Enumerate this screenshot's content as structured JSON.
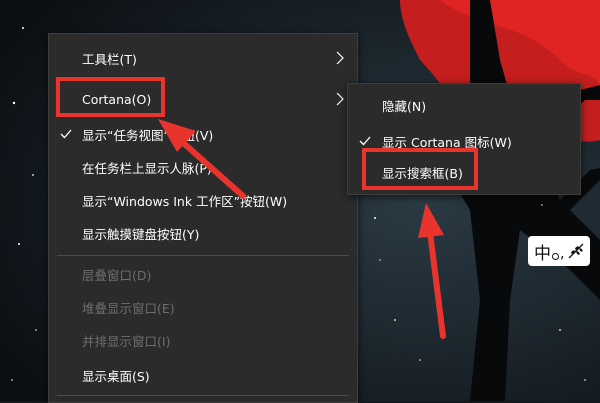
{
  "context_menu": {
    "items": [
      {
        "label": "工具栏(T)",
        "state": "normal",
        "has_submenu": true,
        "checked": false
      },
      {
        "label": "Cortana(O)",
        "state": "normal",
        "has_submenu": true,
        "checked": false
      },
      {
        "label": "显示“任务视图”按钮(V)",
        "state": "normal",
        "has_submenu": false,
        "checked": true
      },
      {
        "label": "在任务栏上显示人脉(P)",
        "state": "normal",
        "has_submenu": false,
        "checked": false
      },
      {
        "label": "显示“Windows Ink 工作区”按钮(W)",
        "state": "normal",
        "has_submenu": false,
        "checked": false
      },
      {
        "label": "显示触摸键盘按钮(Y)",
        "state": "normal",
        "has_submenu": false,
        "checked": false
      },
      {
        "label": "层叠窗口(D)",
        "state": "disabled",
        "has_submenu": false,
        "checked": false
      },
      {
        "label": "堆叠显示窗口(E)",
        "state": "disabled",
        "has_submenu": false,
        "checked": false
      },
      {
        "label": "并排显示窗口(I)",
        "state": "disabled",
        "has_submenu": false,
        "checked": false
      },
      {
        "label": "显示桌面(S)",
        "state": "normal",
        "has_submenu": false,
        "checked": false
      }
    ]
  },
  "cortana_submenu": {
    "items": [
      {
        "label": "隐藏(N)",
        "checked": false
      },
      {
        "label": "显示 Cortana 图标(W)",
        "checked": true
      },
      {
        "label": "显示搜索框(B)",
        "checked": false
      }
    ]
  },
  "ime_indicator": {
    "char": "中",
    "extra": "°,"
  },
  "colors": {
    "menu_bg": "#2b2b2b",
    "annotation": "#e8342d",
    "disabled_text": "#6d6d6d"
  },
  "icons": {
    "check": "check-icon",
    "submenu_arrow": "chevron-right-icon"
  }
}
